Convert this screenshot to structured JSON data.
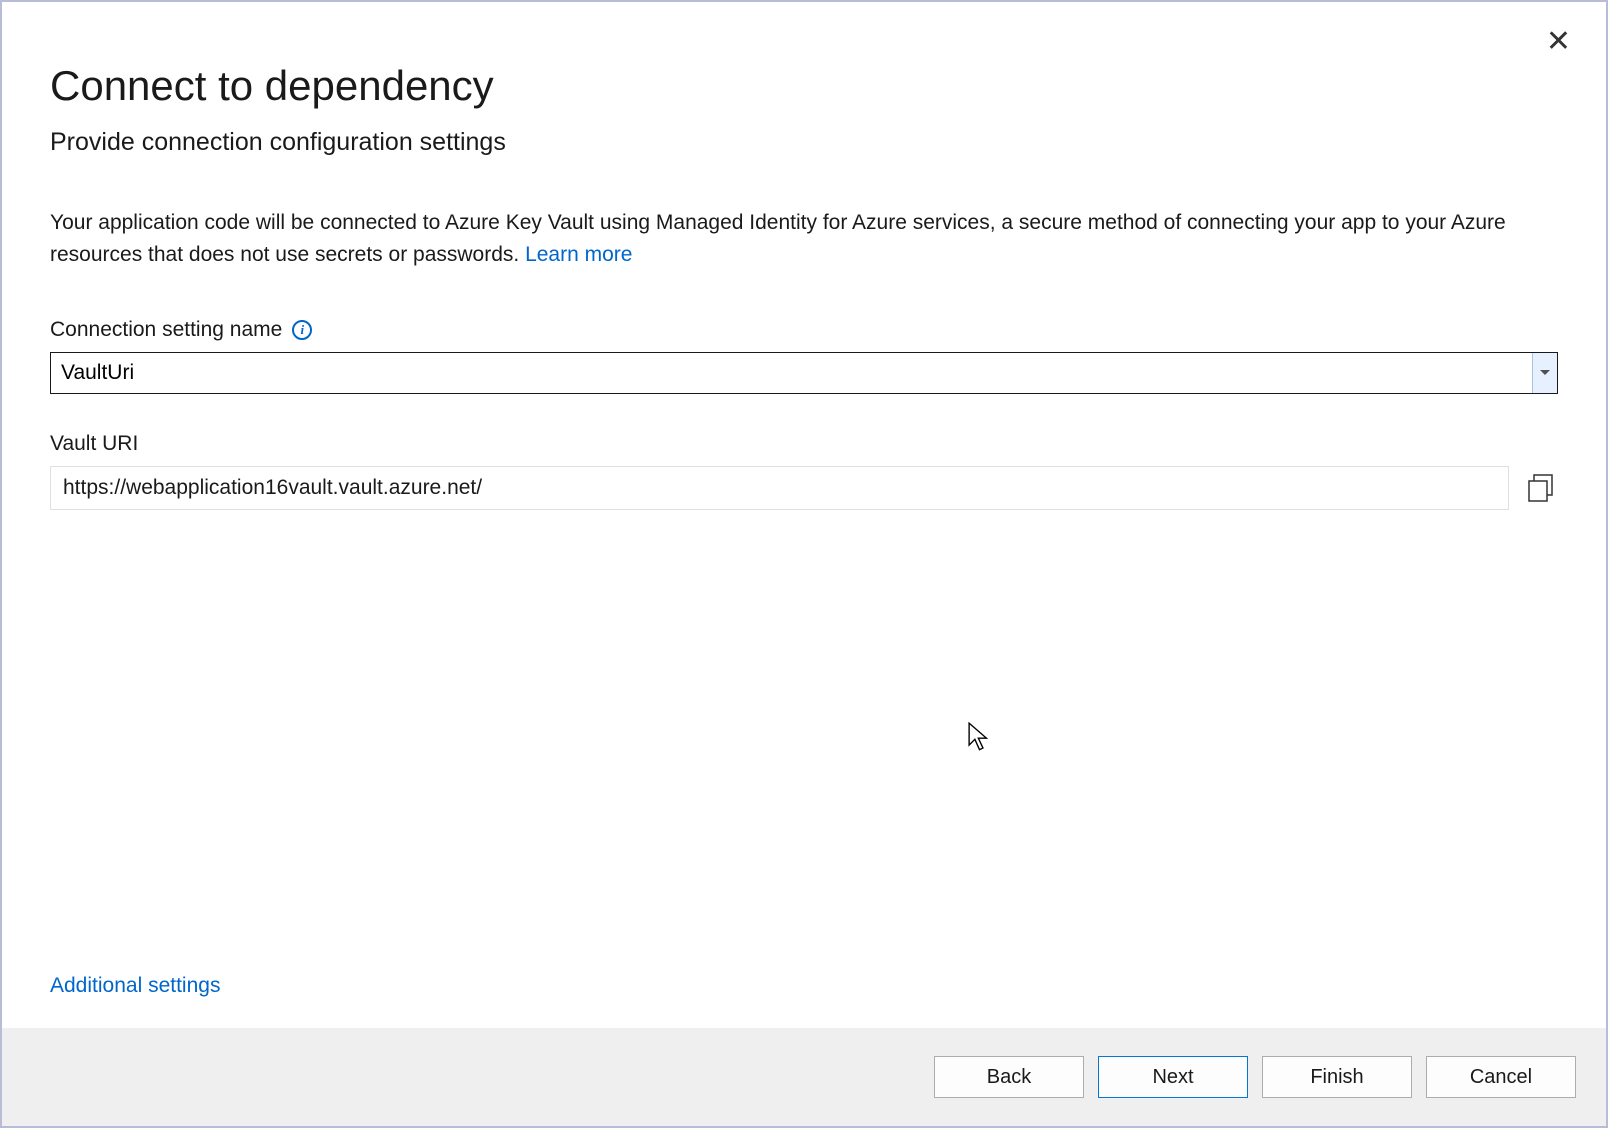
{
  "header": {
    "title": "Connect to dependency",
    "subtitle": "Provide connection configuration settings"
  },
  "description": {
    "text": "Your application code will be connected to Azure Key Vault using Managed Identity for Azure services, a secure method of connecting your app to your Azure resources that does not use secrets or passwords.   ",
    "learn_more": "Learn more"
  },
  "fields": {
    "connection_name": {
      "label": "Connection setting name",
      "value": "VaultUri"
    },
    "vault_uri": {
      "label": "Vault URI",
      "value": "https://webapplication16vault.vault.azure.net/"
    }
  },
  "links": {
    "additional_settings": "Additional settings"
  },
  "buttons": {
    "back": "Back",
    "next": "Next",
    "finish": "Finish",
    "cancel": "Cancel"
  }
}
